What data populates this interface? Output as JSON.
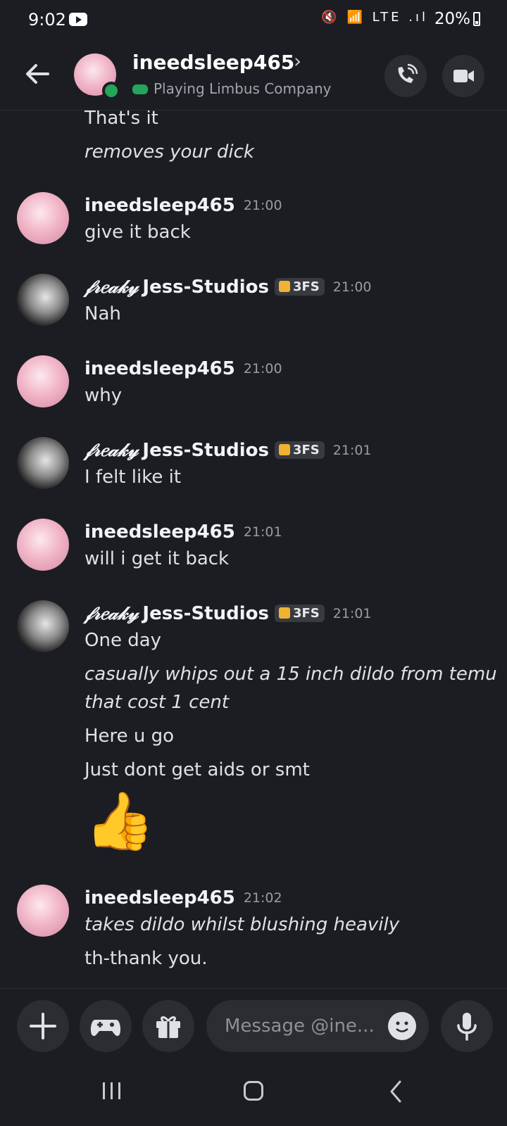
{
  "status_bar": {
    "time": "9:02",
    "icons": "🔇 📶 LTE .ıl",
    "battery": "20%"
  },
  "header": {
    "name": "ineedsleep465",
    "activity_prefix": "Playing ",
    "activity_game": "Limbus Company",
    "icons": {
      "back": "back-arrow-icon",
      "call": "phone-call-icon",
      "video": "video-camera-icon"
    }
  },
  "messages": [
    {
      "lines": [
        "That's it",
        "removes your dick"
      ]
    },
    {
      "author": "ineedsleep465",
      "time": "21:00",
      "lines": [
        "give it back"
      ]
    },
    {
      "author_prefix": "𝒻𝓇𝑒𝒶𝓀𝓎",
      "author": "Freaky Jess-Studios",
      "author_name": "Jess-Studios",
      "tag": "3FS",
      "time": "21:00",
      "lines": [
        "Nah"
      ]
    },
    {
      "author": "ineedsleep465",
      "time": "21:00",
      "lines": [
        "why"
      ]
    },
    {
      "author_prefix": "𝒻𝓇𝑒𝒶𝓀𝓎",
      "author_name": "Jess-Studios",
      "tag": "3FS",
      "time": "21:01",
      "lines": [
        "I felt like it"
      ]
    },
    {
      "author": "ineedsleep465",
      "time": "21:01",
      "lines": [
        "will i get it back"
      ]
    },
    {
      "author_prefix": "𝒻𝓇𝑒𝒶𝓀𝓎",
      "author_name": "Jess-Studios",
      "tag": "3FS",
      "time": "21:01",
      "lines": [
        "One day",
        "casually whips out a 15 inch dildo from temu",
        "that cost 1 cent",
        "Here u go",
        "Just dont get aids or smt"
      ],
      "emoji": "👍"
    },
    {
      "author": "ineedsleep465",
      "time": "21:02",
      "lines": [
        "takes dildo whilst blushing heavily",
        "th-thank you."
      ]
    }
  ],
  "composer": {
    "placeholder": "Message @ine...",
    "icons": {
      "add": "plus-icon",
      "games": "gamepad-icon",
      "gift": "gift-icon",
      "emoji": "emoji-icon",
      "mic": "microphone-icon"
    }
  },
  "colors": {
    "background": "#1c1d22",
    "online": "#23a55a",
    "surface": "#2b2d33"
  }
}
